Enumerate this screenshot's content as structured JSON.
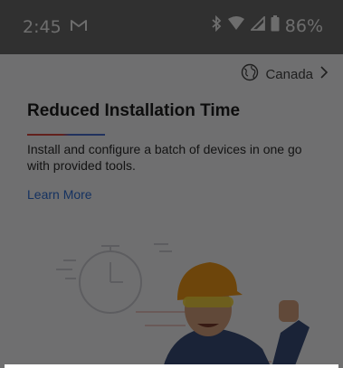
{
  "status_bar": {
    "time": "2:45",
    "battery_percent": "86%",
    "icons": [
      "gmail-icon",
      "bluetooth-icon",
      "wifi-icon",
      "cell-signal-icon",
      "battery-icon"
    ]
  },
  "region": {
    "label": "Canada",
    "icon": "globe-icon",
    "chevron": "chevron-right-icon"
  },
  "feature": {
    "title": "Reduced Installation Time",
    "description": "Install and configure a batch of devices in one go with provided tools.",
    "link": "Learn More"
  },
  "colors": {
    "accent_red": "#d94b42",
    "accent_blue": "#4b6fd1",
    "link_blue": "#2f6fd6",
    "helmet_orange": "#f29a1a"
  }
}
